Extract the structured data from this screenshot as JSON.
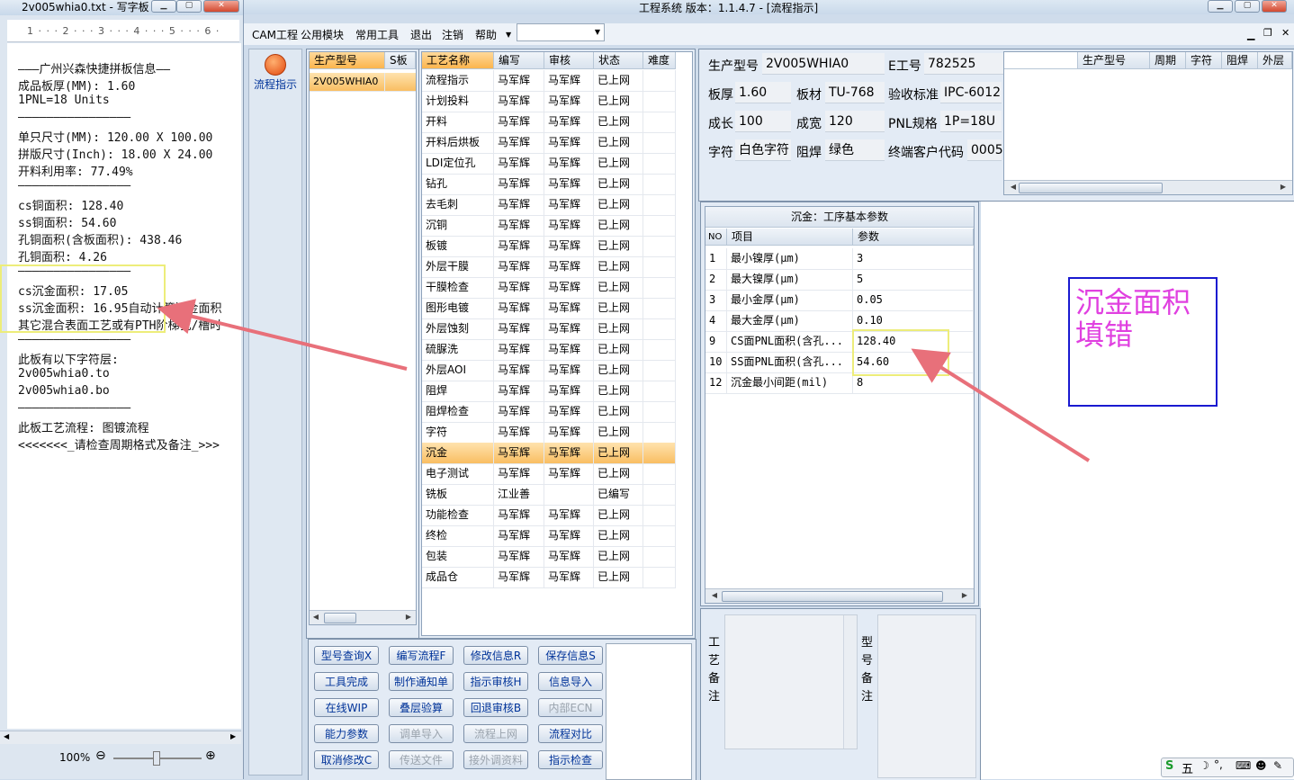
{
  "notepad": {
    "title": "2v005whia0.txt - 写字板",
    "ruler": "1 · · · 2 · · · 3 · · · 4 · · · 5 · · · 6 ·",
    "lines": [
      "———广州兴森快捷拼板信息——",
      "成品板厚(MM): 1.60",
      "1PNL=18 Units",
      "————————————————",
      "单只尺寸(MM): 120.00 X 100.00",
      "拼版尺寸(Inch): 18.00 X 24.00",
      "开料利用率: 77.49%",
      "————————————————",
      "cs铜面积: 128.40",
      "ss铜面积: 54.60",
      "孔铜面积(含板面积): 438.46",
      "孔铜面积: 4.26",
      "————————————————",
      "cs沉金面积: 17.05",
      "ss沉金面积: 16.95自动计算沉金面积",
      "其它混合表面工艺或有PTH阶梯孔/槽时",
      "————————————————",
      "此板有以下字符层:",
      "2v005whia0.to",
      "2v005whia0.bo",
      "————————————————",
      "此板工艺流程: 图镀流程",
      "<<<<<<<_请检查周期格式及备注_>>>"
    ],
    "zoom": "100%"
  },
  "app": {
    "title": "工程系统   版本：1.1.4.7 - [流程指示]",
    "menu": [
      "CAM工程",
      "公用模块",
      "常用工具",
      "退出",
      "注销",
      "帮助"
    ],
    "nav_label": "流程指示"
  },
  "models": {
    "headers": [
      "生产型号",
      "S板"
    ],
    "rows": [
      "2V005WHIA0"
    ]
  },
  "process": {
    "headers": [
      "工艺名称",
      "编写",
      "审核",
      "状态",
      "难度"
    ],
    "rows": [
      [
        "流程指示",
        "马军辉",
        "马军辉",
        "已上网"
      ],
      [
        "计划投料",
        "马军辉",
        "马军辉",
        "已上网"
      ],
      [
        "开料",
        "马军辉",
        "马军辉",
        "已上网"
      ],
      [
        "开料后烘板",
        "马军辉",
        "马军辉",
        "已上网"
      ],
      [
        "LDI定位孔",
        "马军辉",
        "马军辉",
        "已上网"
      ],
      [
        "钻孔",
        "马军辉",
        "马军辉",
        "已上网"
      ],
      [
        "去毛刺",
        "马军辉",
        "马军辉",
        "已上网"
      ],
      [
        "沉铜",
        "马军辉",
        "马军辉",
        "已上网"
      ],
      [
        "板镀",
        "马军辉",
        "马军辉",
        "已上网"
      ],
      [
        "外层干膜",
        "马军辉",
        "马军辉",
        "已上网"
      ],
      [
        "干膜检查",
        "马军辉",
        "马军辉",
        "已上网"
      ],
      [
        "图形电镀",
        "马军辉",
        "马军辉",
        "已上网"
      ],
      [
        "外层蚀刻",
        "马军辉",
        "马军辉",
        "已上网"
      ],
      [
        "硫脲洗",
        "马军辉",
        "马军辉",
        "已上网"
      ],
      [
        "外层AOI",
        "马军辉",
        "马军辉",
        "已上网"
      ],
      [
        "阻焊",
        "马军辉",
        "马军辉",
        "已上网"
      ],
      [
        "阻焊检查",
        "马军辉",
        "马军辉",
        "已上网"
      ],
      [
        "字符",
        "马军辉",
        "马军辉",
        "已上网"
      ],
      [
        "沉金",
        "马军辉",
        "马军辉",
        "已上网"
      ],
      [
        "电子测试",
        "马军辉",
        "马军辉",
        "已上网"
      ],
      [
        "铣板",
        "江业善",
        "",
        "已编写"
      ],
      [
        "功能检查",
        "马军辉",
        "马军辉",
        "已上网"
      ],
      [
        "终检",
        "马军辉",
        "马军辉",
        "已上网"
      ],
      [
        "包装",
        "马军辉",
        "马军辉",
        "已上网"
      ],
      [
        "成品仓",
        "马军辉",
        "马军辉",
        "已上网"
      ]
    ],
    "selected_index": 18
  },
  "buttons": [
    [
      "型号查询X",
      "编写流程F",
      "修改信息R",
      "保存信息S"
    ],
    [
      "工具完成",
      "制作通知单",
      "指示审核H",
      "信息导入"
    ],
    [
      "在线WIP",
      "叠层验算",
      "回退审核B",
      "内部ECN"
    ],
    [
      "能力参数",
      "调单导入",
      "流程上网",
      "流程对比"
    ],
    [
      "取消修改C",
      "传送文件",
      "接外调资料",
      "指示检查"
    ]
  ],
  "disabled_buttons": [
    "内部ECN",
    "调单导入",
    "流程上网",
    "传送文件",
    "接外调资料"
  ],
  "info": {
    "model_label": "生产型号",
    "model": "2V005WHIA0",
    "eno_label": "E工号",
    "eno": "782525",
    "thick_label": "板厚",
    "thick": "1.60",
    "mat_label": "板材",
    "mat": "TU-768",
    "std_label": "验收标准",
    "std": "IPC-6012",
    "len_label": "成长",
    "len": "100",
    "wid_label": "成宽",
    "wid": "120",
    "pnl_label": "PNL规格",
    "pnl": "1P=18U",
    "char_label": "字符",
    "char": "白色字符",
    "mask_label": "阻焊",
    "mask": "绿色",
    "cust_label": "终端客户代码",
    "cust": "0005"
  },
  "layers": {
    "headers": [
      "生产型号",
      "周期",
      "字符",
      "阻焊",
      "外层"
    ]
  },
  "params": {
    "title": "沉金：工序基本参数",
    "headers": [
      "NO",
      "项目",
      "参数"
    ],
    "rows": [
      [
        "1",
        "最小镍厚(μm)",
        "3"
      ],
      [
        "2",
        "最大镍厚(μm)",
        "5"
      ],
      [
        "3",
        "最小金厚(μm)",
        "0.05"
      ],
      [
        "4",
        "最大金厚(μm)",
        "0.10"
      ],
      [
        "9",
        "CS面PNL面积(含孔...",
        "128.40"
      ],
      [
        "10",
        "SS面PNL面积(含孔...",
        "54.60"
      ],
      [
        "12",
        "沉金最小间距(mil)",
        "8"
      ]
    ]
  },
  "notes": {
    "process_note_label": "工艺备注",
    "model_note_label": "型号备注"
  },
  "annotation": {
    "text_line1": "沉金面积",
    "text_line2": "填错",
    "text_color": "#e040e0",
    "box_color": "#1a1ad0",
    "arrow_color": "#e8707a",
    "highlight_color": "#eded7a"
  },
  "taskbar": {
    "ime": "五"
  }
}
